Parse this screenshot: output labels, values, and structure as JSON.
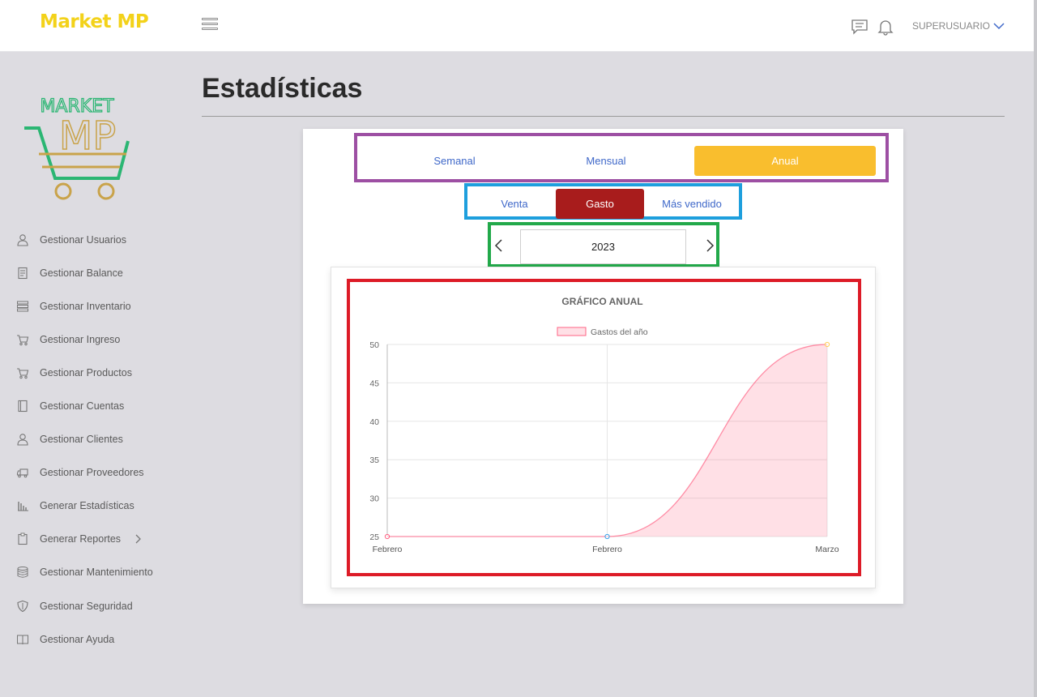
{
  "header": {
    "brand": "Market MP",
    "user_label": "SUPERUSUARIO",
    "icons": [
      "menu-icon",
      "chat-icon",
      "bell-icon",
      "chevron-down-icon"
    ]
  },
  "sidebar": {
    "logo_text_top": "MARKET",
    "logo_text_bottom": "MP",
    "items": [
      {
        "label": "Gestionar Usuarios",
        "icon": "user-icon"
      },
      {
        "label": "Gestionar Balance",
        "icon": "receipt-icon"
      },
      {
        "label": "Gestionar Inventario",
        "icon": "server-icon"
      },
      {
        "label": "Gestionar Ingreso",
        "icon": "cart-icon"
      },
      {
        "label": "Gestionar Productos",
        "icon": "cart-icon"
      },
      {
        "label": "Gestionar Cuentas",
        "icon": "book-icon"
      },
      {
        "label": "Gestionar Clientes",
        "icon": "user-icon"
      },
      {
        "label": "Gestionar Proveedores",
        "icon": "truck-icon"
      },
      {
        "label": "Generar Estadísticas",
        "icon": "bar-chart-icon"
      },
      {
        "label": "Generar Reportes",
        "icon": "clipboard-icon"
      },
      {
        "label": "Gestionar Mantenimiento",
        "icon": "database-icon"
      },
      {
        "label": "Gestionar Seguridad",
        "icon": "shield-icon"
      },
      {
        "label": "Gestionar Ayuda",
        "icon": "open-book-icon"
      }
    ]
  },
  "page": {
    "title": "Estadísticas"
  },
  "period_tabs": [
    "Semanal",
    "Mensual",
    "Anual"
  ],
  "type_tabs": [
    "Venta",
    "Gasto",
    "Más vendido"
  ],
  "year_selector": {
    "value": "2023"
  },
  "colors": {
    "brand": "#f3d21a",
    "active_period": "#f9be2e",
    "active_type": "#a81c1c",
    "link": "#3f68c9",
    "highlight_purple": "#9d4fa3",
    "highlight_blue": "#1e9fdd",
    "highlight_green": "#22a94a",
    "highlight_red": "#dd1b27"
  },
  "chart_data": {
    "type": "area",
    "title": "GRÁFICO ANUAL",
    "categories": [
      "Febrero",
      "Febrero",
      "Marzo"
    ],
    "series": [
      {
        "name": "Gastos del año",
        "values": [
          25,
          25,
          50
        ],
        "color": "#ff6384"
      }
    ],
    "ylim": [
      25,
      50
    ],
    "yticks": [
      25,
      30,
      35,
      40,
      45,
      50
    ],
    "grid": true,
    "legend": "top"
  }
}
